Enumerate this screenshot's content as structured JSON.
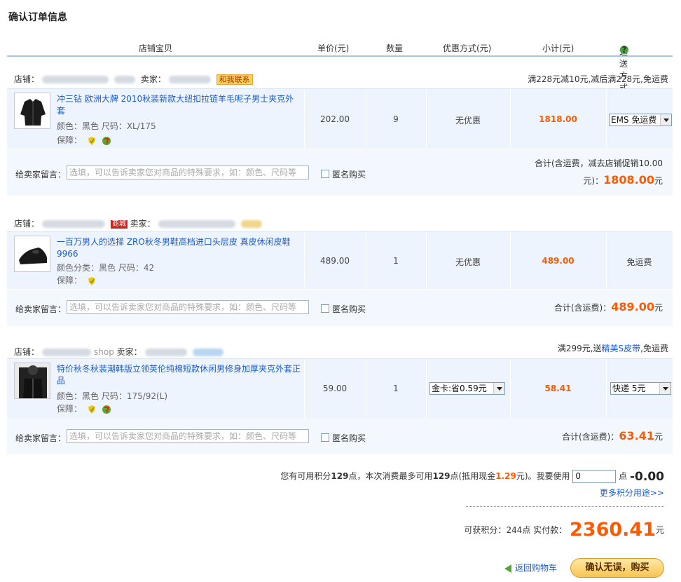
{
  "title": "确认订单信息",
  "header": {
    "product": "店铺宝贝",
    "price": "单价(元)",
    "qty": "数量",
    "discount": "优惠方式(元)",
    "subtotal": "小计(元)",
    "shipping": "运送方式"
  },
  "orders": [
    {
      "shop_label": "店铺：",
      "seller_label": "卖家：",
      "contact": "和我联系",
      "promo": "满228元减10元,减后满228元,免运费",
      "item": {
        "title": "冲三钻 欧洲大牌 2010秋装新款大纽扣拉链羊毛呢子男士夹克外套",
        "attrs": "颜色：黑色   尺码：XL/175",
        "insure": "保障：",
        "price": "202.00",
        "qty": "9",
        "discount": "无优惠",
        "subtotal": "1818.00",
        "shipping": "EMS 免运费"
      },
      "msg_label": "给卖家留言：",
      "msg_placeholder": "选填，可以告诉卖家您对商品的特殊要求，如：颜色、尺码等",
      "anon": "匿名购买",
      "total_line1": "合计(含运费，减去店铺促销10.00",
      "total_prefix": "元)：",
      "total": "1808.00",
      "total_unit": "元"
    },
    {
      "shop_label": "店铺：",
      "seller_label": "卖家：",
      "badge": "商城",
      "promo": "",
      "item": {
        "title": "一百万男人的选择 ZRO秋冬男鞋高档进口头层皮 真皮休闲皮鞋9966",
        "attrs": "颜色分类：黑色    尺码：42",
        "insure": "保障：",
        "price": "489.00",
        "qty": "1",
        "discount": "无优惠",
        "subtotal": "489.00",
        "shipping": "免运费"
      },
      "msg_label": "给卖家留言：",
      "msg_placeholder": "选填，可以告诉卖家您对商品的特殊要求，如：颜色、尺码等",
      "anon": "匿名购买",
      "total_prefix": "合计(含运费)：",
      "total": "489.00",
      "total_unit": "元"
    },
    {
      "shop_label": "店铺：",
      "seller_label": "卖家：",
      "shop_name": "shop",
      "promo": "满299元,送",
      "promo_link": "精美S皮带",
      "promo_tail": ",免运费",
      "item": {
        "title": "特价秋冬秋装潮韩版立领英伦纯棉短款休闲男修身加厚夹克外套正品",
        "attrs": "颜色：黑色   尺码：175/92(L)",
        "insure": "保障：",
        "price": "59.00",
        "qty": "1",
        "discount": "金卡:省0.59元",
        "subtotal": "58.41",
        "shipping": "快递  5元"
      },
      "msg_label": "给卖家留言：",
      "msg_placeholder": "选填，可以告诉卖家您对商品的特殊要求，如：颜色、尺码等",
      "anon": "匿名购买",
      "total_prefix": "合计(含运费)：",
      "total": "63.41",
      "total_unit": "元"
    }
  ],
  "points": {
    "t1": "您有可用积分",
    "avail": "129",
    "t2": "点，本次消费最多可用",
    "max": "129",
    "t3": "点(抵用现金",
    "cash": "1.29",
    "t4": "元)。我要使用",
    "input": "0",
    "t5": "点",
    "deduct": "-0.00",
    "more": "更多积分用途>>"
  },
  "final": {
    "earn_label": "可获积分：",
    "earn": "244",
    "earn_unit": "点 实付款：",
    "amount": "2360.41",
    "unit": "元"
  },
  "actions": {
    "back": "返回购物车",
    "confirm": "确认无误，购买"
  }
}
